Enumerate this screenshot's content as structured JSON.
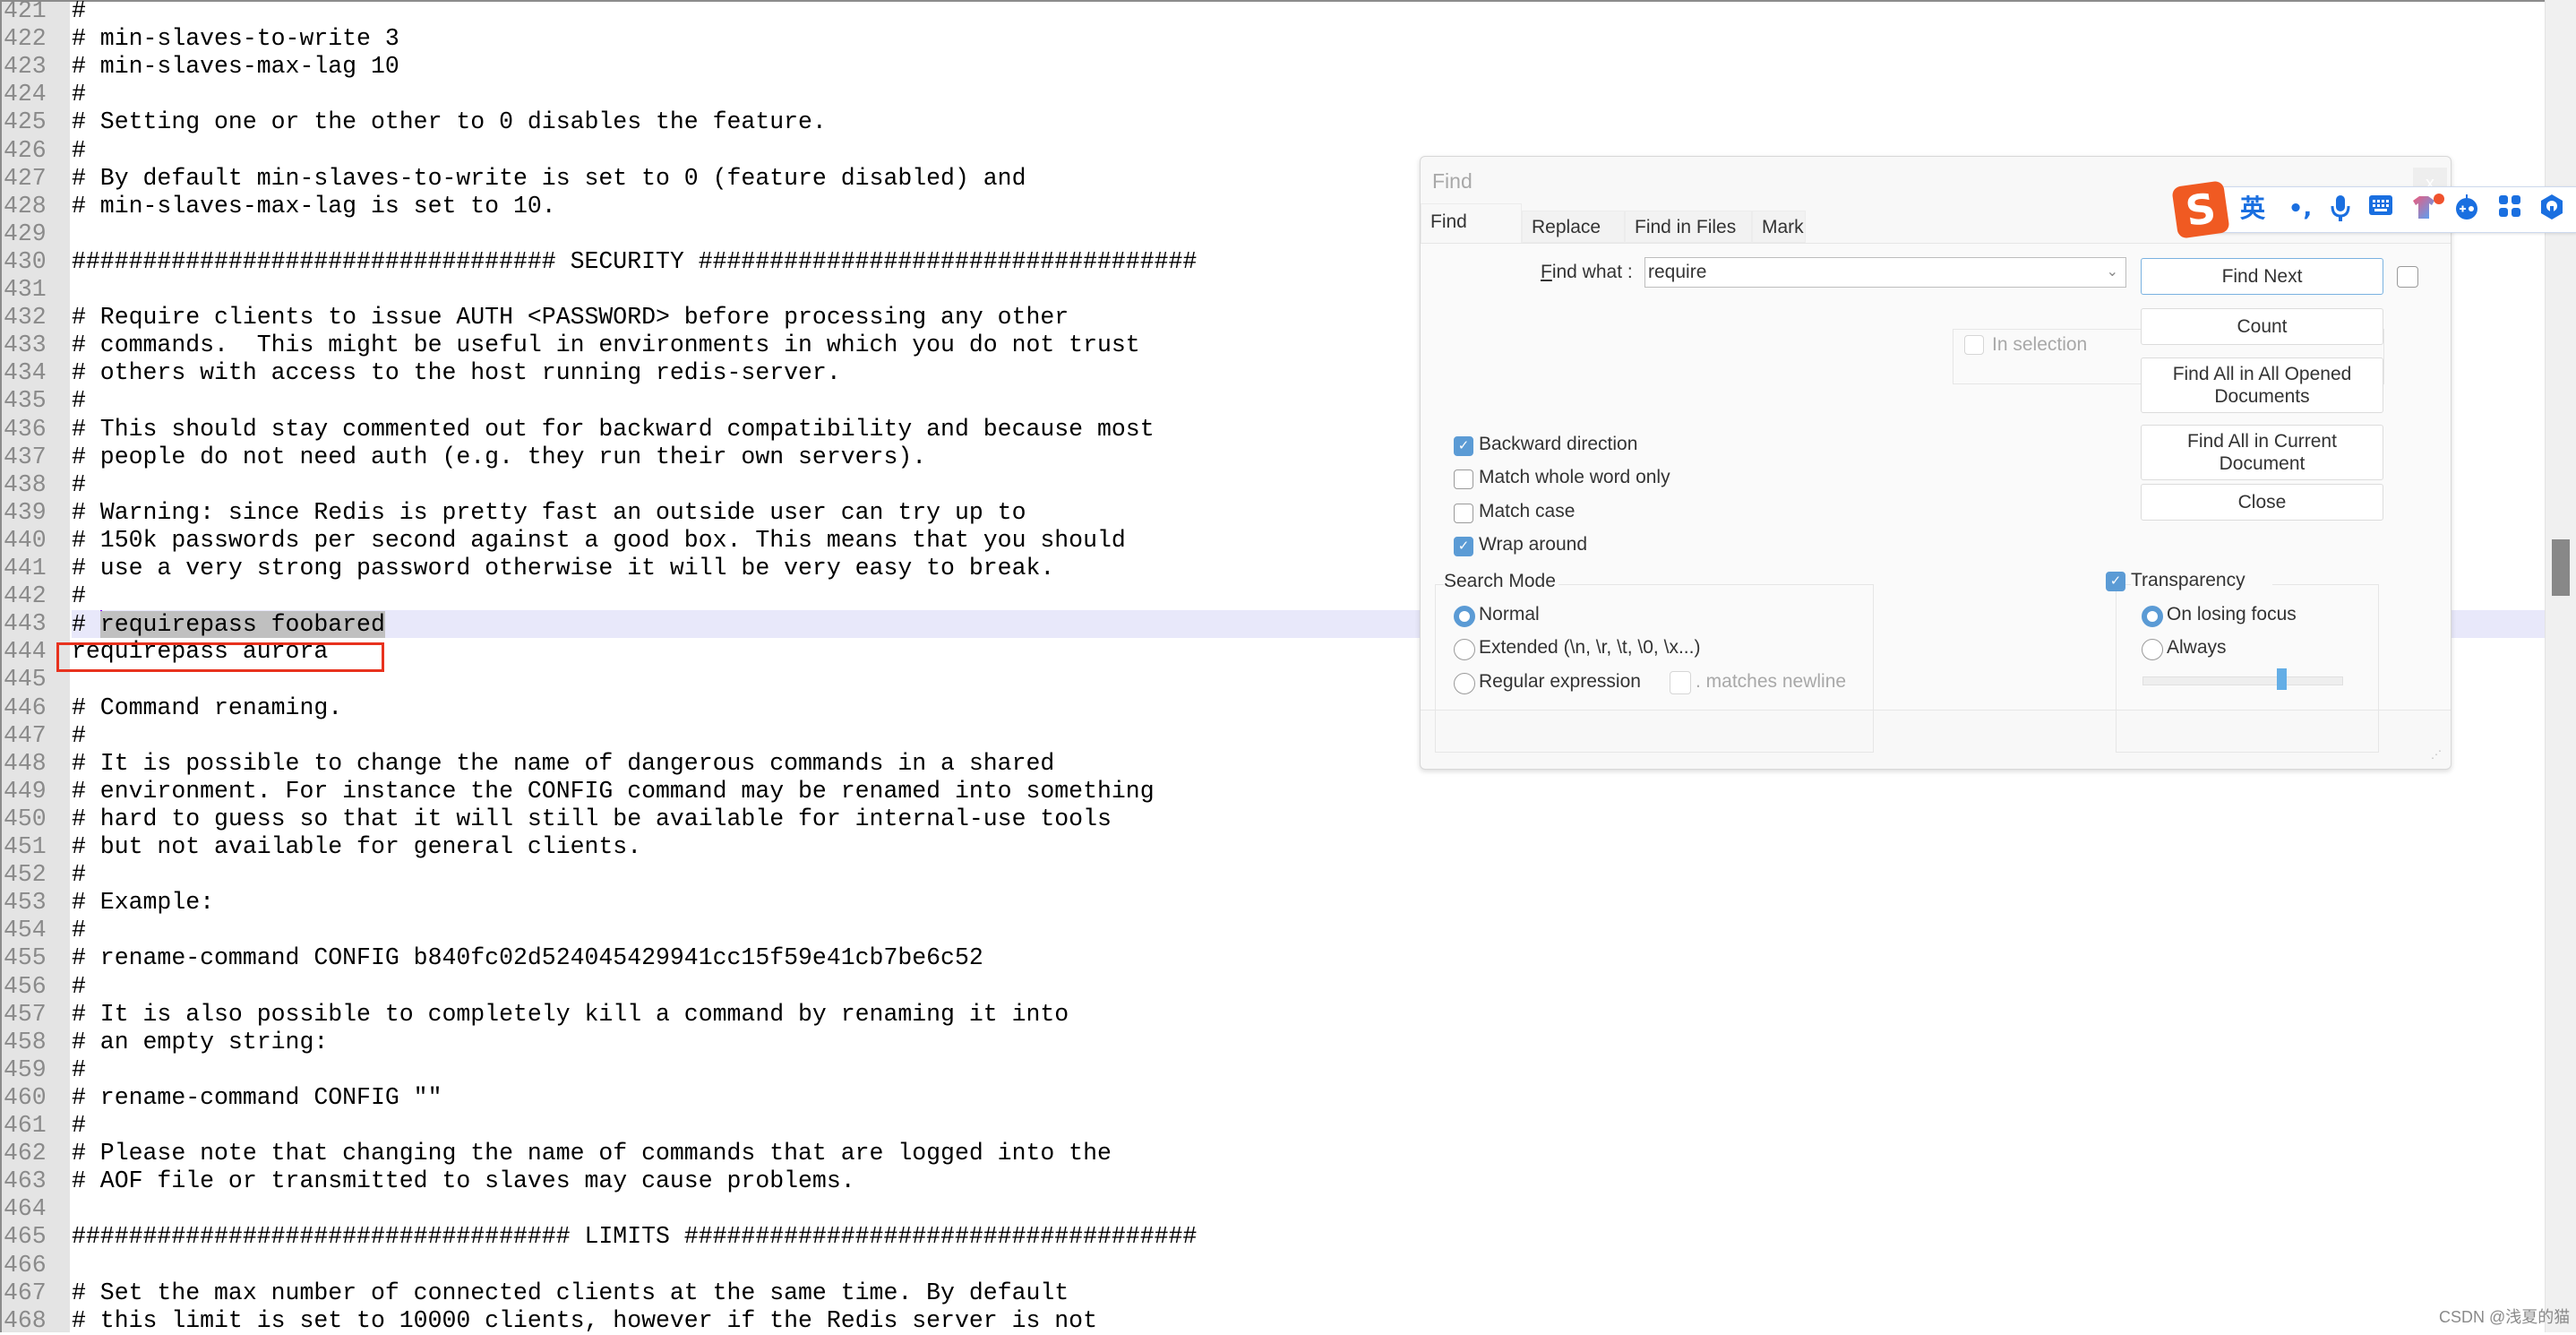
{
  "editor": {
    "lines": [
      {
        "n": "421",
        "text": "#"
      },
      {
        "n": "422",
        "text": "# min-slaves-to-write 3"
      },
      {
        "n": "423",
        "text": "# min-slaves-max-lag 10"
      },
      {
        "n": "424",
        "text": "#"
      },
      {
        "n": "425",
        "text": "# Setting one or the other to 0 disables the feature."
      },
      {
        "n": "426",
        "text": "#"
      },
      {
        "n": "427",
        "text": "# By default min-slaves-to-write is set to 0 (feature disabled) and"
      },
      {
        "n": "428",
        "text": "# min-slaves-max-lag is set to 10."
      },
      {
        "n": "429",
        "text": ""
      },
      {
        "n": "430",
        "text": "################################## SECURITY ###################################"
      },
      {
        "n": "431",
        "text": ""
      },
      {
        "n": "432",
        "text": "# Require clients to issue AUTH <PASSWORD> before processing any other"
      },
      {
        "n": "433",
        "text": "# commands.  This might be useful in environments in which you do not trust"
      },
      {
        "n": "434",
        "text": "# others with access to the host running redis-server."
      },
      {
        "n": "435",
        "text": "#"
      },
      {
        "n": "436",
        "text": "# This should stay commented out for backward compatibility and because most"
      },
      {
        "n": "437",
        "text": "# people do not need auth (e.g. they run their own servers)."
      },
      {
        "n": "438",
        "text": "#"
      },
      {
        "n": "439",
        "text": "# Warning: since Redis is pretty fast an outside user can try up to"
      },
      {
        "n": "440",
        "text": "# 150k passwords per second against a good box. This means that you should"
      },
      {
        "n": "441",
        "text": "# use a very strong password otherwise it will be very easy to break."
      },
      {
        "n": "442",
        "text": "#"
      },
      {
        "n": "443",
        "text": "# ",
        "selected": "requirepass foobared"
      },
      {
        "n": "444",
        "text": "requirepass aurora"
      },
      {
        "n": "445",
        "text": ""
      },
      {
        "n": "446",
        "text": "# Command renaming."
      },
      {
        "n": "447",
        "text": "#"
      },
      {
        "n": "448",
        "text": "# It is possible to change the name of dangerous commands in a shared"
      },
      {
        "n": "449",
        "text": "# environment. For instance the CONFIG command may be renamed into something"
      },
      {
        "n": "450",
        "text": "# hard to guess so that it will still be available for internal-use tools"
      },
      {
        "n": "451",
        "text": "# but not available for general clients."
      },
      {
        "n": "452",
        "text": "#"
      },
      {
        "n": "453",
        "text": "# Example:"
      },
      {
        "n": "454",
        "text": "#"
      },
      {
        "n": "455",
        "text": "# rename-command CONFIG b840fc02d524045429941cc15f59e41cb7be6c52"
      },
      {
        "n": "456",
        "text": "#"
      },
      {
        "n": "457",
        "text": "# It is also possible to completely kill a command by renaming it into"
      },
      {
        "n": "458",
        "text": "# an empty string:"
      },
      {
        "n": "459",
        "text": "#"
      },
      {
        "n": "460",
        "text": "# rename-command CONFIG \"\""
      },
      {
        "n": "461",
        "text": "#"
      },
      {
        "n": "462",
        "text": "# Please note that changing the name of commands that are logged into the"
      },
      {
        "n": "463",
        "text": "# AOF file or transmitted to slaves may cause problems."
      },
      {
        "n": "464",
        "text": ""
      },
      {
        "n": "465",
        "text": "################################### LIMITS ####################################"
      },
      {
        "n": "466",
        "text": ""
      },
      {
        "n": "467",
        "text": "# Set the max number of connected clients at the same time. By default"
      },
      {
        "n": "468",
        "text": "# this limit is set to 10000 clients, however if the Redis server is not"
      }
    ],
    "current_line": "443",
    "highlighted_line": "444"
  },
  "find_dialog": {
    "title": "Find",
    "close_label": "x",
    "tabs": [
      {
        "label": "Find",
        "active": true
      },
      {
        "label": "Replace",
        "active": false
      },
      {
        "label": "Find in Files",
        "active": false
      },
      {
        "label": "Mark",
        "active": false
      }
    ],
    "find_what_label_prefix": "F",
    "find_what_label_rest": "ind what :",
    "find_what_value": "require",
    "in_selection_label": "In selection",
    "buttons": {
      "find_next": "Find Next",
      "count": "Count",
      "find_all_opened_1": "Find All in All Opened",
      "find_all_opened_2": "Documents",
      "find_all_current_1": "Find All in Current",
      "find_all_current_2": "Document",
      "close": "Close"
    },
    "options": {
      "backward_direction": {
        "label": "Backward direction",
        "checked": true
      },
      "match_whole_word": {
        "label": "Match whole word only",
        "checked": false
      },
      "match_case": {
        "label": "Match case",
        "checked": false
      },
      "wrap_around": {
        "label": "Wrap around",
        "checked": true
      }
    },
    "search_mode": {
      "title": "Search Mode",
      "options": [
        {
          "label": "Normal",
          "checked": true
        },
        {
          "label": "Extended (\\n, \\r, \\t, \\0, \\x...)",
          "checked": false
        },
        {
          "label": "Regular expression",
          "checked": false
        }
      ],
      "matches_newline_label": ". matches newline",
      "matches_newline_checked": false
    },
    "transparency": {
      "label": "Transparency",
      "checked": true,
      "options": [
        {
          "label": "On losing focus",
          "checked": true
        },
        {
          "label": "Always",
          "checked": false
        }
      ],
      "level_percent": 70
    }
  },
  "ime_toolbar": {
    "logo": "S",
    "mode_label": "英",
    "punct_label": "•,",
    "icons": [
      "microphone-icon",
      "keyboard-icon",
      "skin-icon",
      "game-icon",
      "apps-icon",
      "settings-icon"
    ]
  },
  "watermark": "CSDN @浅夏的猫",
  "colors": {
    "accent": "#5b9bd5",
    "annotation_box": "#e8321e",
    "selection": "#c0c0c0",
    "current_line": "#e8e8fa",
    "ime_logo": "#f05a22",
    "ime_icon": "#1a6fe0"
  }
}
